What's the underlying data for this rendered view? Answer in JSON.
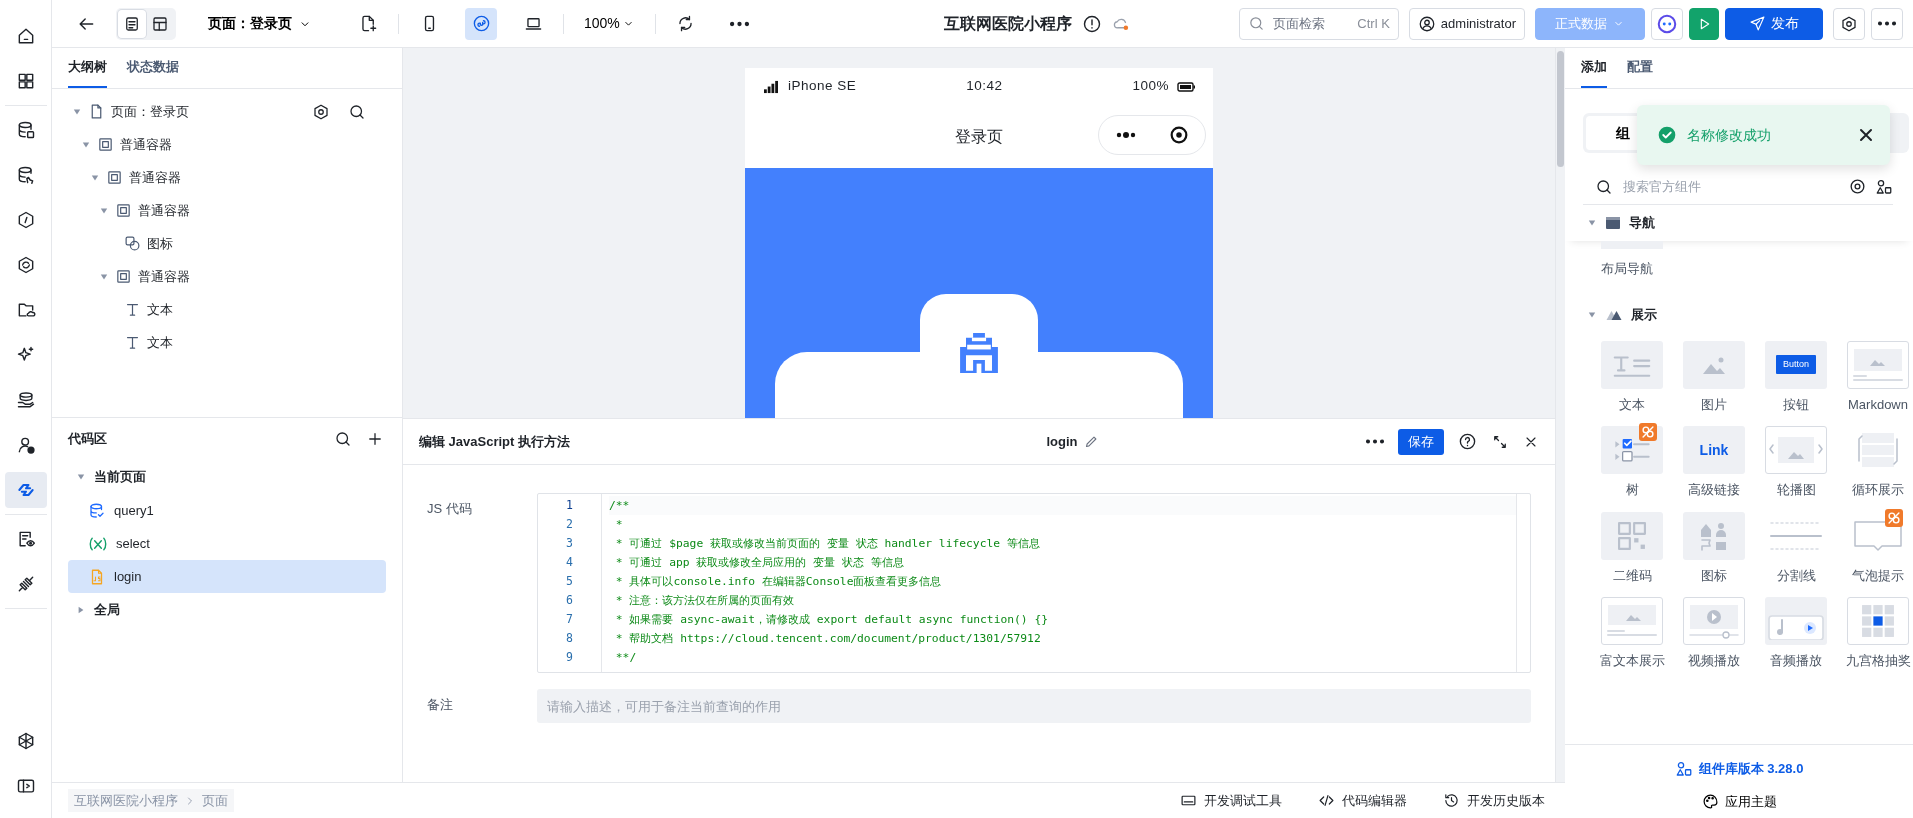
{
  "toolbar": {
    "views": [
      {
        "selected": true
      },
      {
        "selected": false
      }
    ],
    "page_selector": "页面：登录页",
    "devices": [
      {
        "selected": false
      },
      {
        "selected": true
      },
      {
        "selected": false
      }
    ],
    "zoom": "100%",
    "app_title": "互联网医院小程序",
    "search": {
      "placeholder": "页面检索",
      "shortcut": "Ctrl K"
    },
    "user": "administrator",
    "data_source": {
      "label": "正式数据",
      "disabled": true
    },
    "publish": "发布"
  },
  "rail": [
    [
      {
        "selected": false
      },
      {
        "selected": false
      }
    ],
    [
      {
        "selected": false
      },
      {
        "selected": false
      },
      {
        "selected": false
      },
      {
        "selected": false
      },
      {
        "selected": false
      },
      {
        "selected": false
      },
      {
        "selected": false
      },
      {
        "selected": false
      },
      {
        "selected": true
      }
    ],
    [
      {
        "selected": false
      },
      {
        "selected": false
      }
    ],
    [
      {
        "selected": false
      },
      {
        "selected": false
      }
    ]
  ],
  "outline": {
    "tabs": [
      {
        "label": "大纲树",
        "selected": true
      },
      {
        "label": "状态数据",
        "selected": false
      }
    ],
    "tree": [
      {
        "label": "页面：登录页",
        "kind": "page",
        "expanded": true,
        "children": [
          {
            "label": "普通容器",
            "kind": "container",
            "expanded": true,
            "children": [
              {
                "label": "普通容器",
                "kind": "container",
                "expanded": true,
                "children": [
                  {
                    "label": "普通容器",
                    "kind": "container",
                    "expanded": true,
                    "children": [
                      {
                        "label": "图标",
                        "kind": "icon"
                      }
                    ]
                  },
                  {
                    "label": "普通容器",
                    "kind": "container",
                    "expanded": true,
                    "children": [
                      {
                        "label": "文本",
                        "kind": "text"
                      },
                      {
                        "label": "文本",
                        "kind": "text"
                      }
                    ]
                  }
                ]
              }
            ]
          }
        ]
      }
    ]
  },
  "code_area": {
    "title": "代码区",
    "groups": [
      {
        "label": "当前页面",
        "expanded": true,
        "items": [
          {
            "label": "query1",
            "kind": "query",
            "selected": false
          },
          {
            "label": "select",
            "kind": "variable",
            "selected": false
          },
          {
            "label": "login",
            "kind": "script",
            "selected": true
          }
        ]
      },
      {
        "label": "全局",
        "expanded": false
      }
    ]
  },
  "phone": {
    "carrier": "iPhone SE",
    "time": "10:42",
    "battery": "100%",
    "title": "登录页"
  },
  "editor": {
    "title": "编辑 JavaScript 执行方法",
    "name": "login",
    "save": "保存",
    "code_label": "JS 代码",
    "lines": [
      {
        "number": "1",
        "text": "/**",
        "current": true
      },
      {
        "number": "2",
        "text": " *",
        "current": false
      },
      {
        "number": "3",
        "text": " * 可通过 $page 获取或修改当前页面的 变量 状态 handler lifecycle 等信息",
        "current": false
      },
      {
        "number": "4",
        "text": " * 可通过 app 获取或修改全局应用的 变量 状态 等信息",
        "current": false
      },
      {
        "number": "5",
        "text": " * 具体可以console.info 在编辑器Console面板查看更多信息",
        "current": false
      },
      {
        "number": "6",
        "text": " * 注意：该方法仅在所属的页面有效",
        "current": false
      },
      {
        "number": "7",
        "text": " * 如果需要 async-await，请修改成 export default async function() {}",
        "current": false
      },
      {
        "number": "8",
        "text": " * 帮助文档 ",
        "link": "https://cloud.tencent.com/document/product/1301/57912",
        "current": false
      },
      {
        "number": "9",
        "text": " **/",
        "current": false
      }
    ],
    "notes_label": "备注",
    "notes": {
      "placeholder": "请输入描述，可用于备注当前查询的作用"
    }
  },
  "bottom_bar": {
    "breadcrumb": [
      "互联网医院小程序",
      "页面"
    ],
    "tools": [
      {
        "label": "开发调试工具",
        "kind": "debug"
      },
      {
        "label": "代码编辑器",
        "kind": "code"
      },
      {
        "label": "开发历史版本",
        "kind": "history"
      }
    ]
  },
  "right_panel": {
    "tabs": [
      {
        "label": "添加",
        "selected": true
      },
      {
        "label": "配置",
        "selected": false
      }
    ],
    "segment": "组",
    "search": {
      "placeholder": "搜索官方组件"
    },
    "sections": [
      {
        "label": "导航",
        "kind": "nav",
        "expanded": true,
        "items": [
          {
            "label": "布局导航",
            "kind": "layout-nav",
            "badge": false
          }
        ]
      },
      {
        "label": "展示",
        "kind": "display",
        "expanded": true,
        "items": [
          {
            "label": "文本",
            "kind": "text",
            "badge": false
          },
          {
            "label": "图片",
            "kind": "image",
            "badge": false
          },
          {
            "label": "按钮",
            "kind": "button",
            "thumb_text": "Button",
            "badge": false
          },
          {
            "label": "Markdown",
            "kind": "markdown",
            "badge": false
          },
          {
            "label": "树",
            "kind": "tree",
            "badge": true
          },
          {
            "label": "高级链接",
            "kind": "link",
            "thumb_text": "Link",
            "badge": false
          },
          {
            "label": "轮播图",
            "kind": "carousel",
            "badge": false
          },
          {
            "label": "循环展示",
            "kind": "loop",
            "badge": false
          },
          {
            "label": "二维码",
            "kind": "qrcode",
            "badge": false
          },
          {
            "label": "图标",
            "kind": "icons",
            "badge": false
          },
          {
            "label": "分割线",
            "kind": "divider",
            "badge": false
          },
          {
            "label": "气泡提示",
            "kind": "tooltip",
            "badge": true
          },
          {
            "label": "富文本展示",
            "kind": "richtext",
            "badge": false
          },
          {
            "label": "视频播放",
            "kind": "video",
            "badge": false
          },
          {
            "label": "音频播放",
            "kind": "audio",
            "badge": false
          },
          {
            "label": "九宫格抽奖",
            "kind": "lottery",
            "badge": false
          }
        ]
      }
    ],
    "version": "组件库版本 3.28.0",
    "theme": "应用主题",
    "toast": {
      "message": "名称修改成功"
    }
  }
}
